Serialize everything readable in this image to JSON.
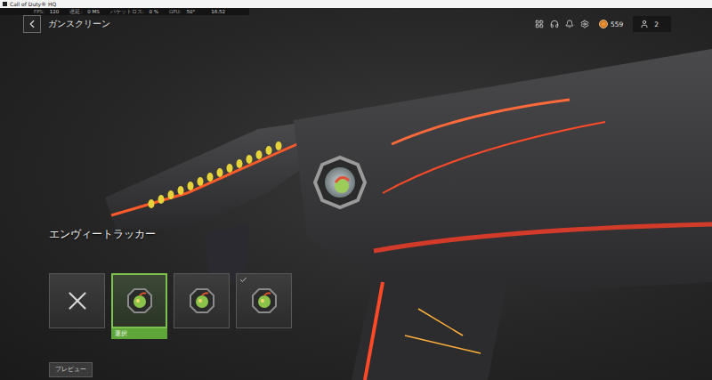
{
  "window": {
    "title": "Call of Duty® HQ"
  },
  "stats": [
    {
      "label": "FPS:",
      "value": "120"
    },
    {
      "label": "遅延:",
      "value": "0 MS"
    },
    {
      "label": "パケットロス:",
      "value": "0 %"
    },
    {
      "label": "GPU:",
      "value": "50°"
    },
    {
      "label": "",
      "value": "16:52"
    }
  ],
  "header": {
    "title": "ガンスクリーン"
  },
  "toolbar": {
    "currency": "559",
    "friends": "2"
  },
  "tracker": {
    "name": "エンヴィートラッカー",
    "selected_label": "選択",
    "options": [
      {
        "kind": "none",
        "selected": false,
        "equipped": false
      },
      {
        "kind": "tracker",
        "selected": true,
        "equipped": false
      },
      {
        "kind": "tracker",
        "selected": false,
        "equipped": false
      },
      {
        "kind": "tracker",
        "selected": false,
        "equipped": true
      }
    ]
  },
  "preview_button": "プレビュー"
}
